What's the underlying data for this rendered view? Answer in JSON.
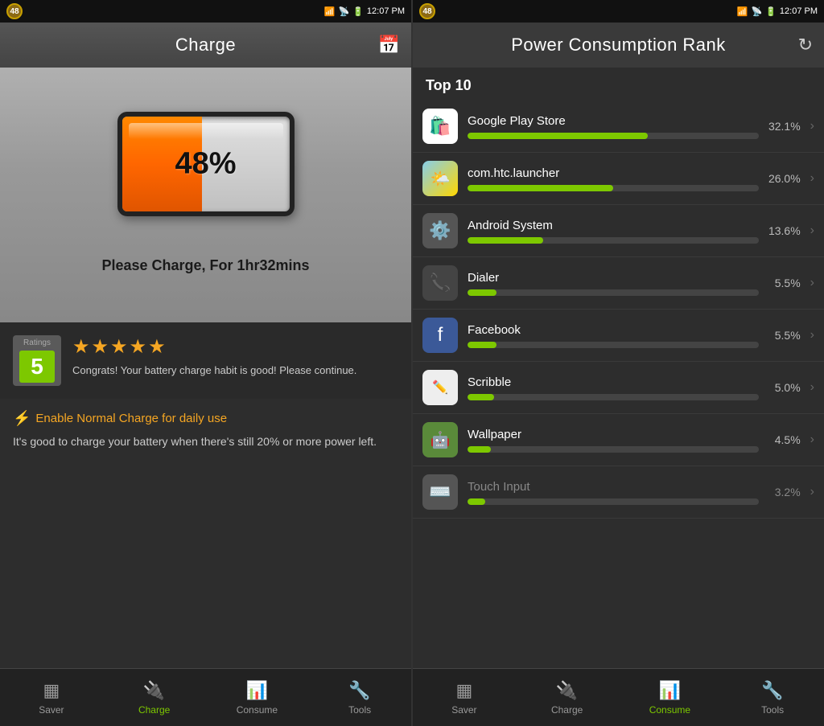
{
  "statusBar": {
    "badge": "48",
    "time": "12:07 PM"
  },
  "leftPanel": {
    "header": {
      "title": "Charge",
      "icon": "📅"
    },
    "battery": {
      "percent": "48%",
      "fillWidth": "48%"
    },
    "chargeMessage": "Please Charge, For 1hr32mins",
    "ratings": {
      "label": "Ratings",
      "score": "5",
      "stars": "★★★★★",
      "text": "Congrats! Your battery charge habit is good! Please continue."
    },
    "tip": {
      "title": "Enable Normal Charge for daily use",
      "text": "It's good to charge your battery when there's still 20% or more power left."
    },
    "nav": [
      {
        "id": "saver",
        "label": "Saver",
        "active": false
      },
      {
        "id": "charge",
        "label": "Charge",
        "active": true
      },
      {
        "id": "consume",
        "label": "Consume",
        "active": false
      },
      {
        "id": "tools",
        "label": "Tools",
        "active": false
      }
    ]
  },
  "rightPanel": {
    "header": {
      "title": "Power Consumption Rank",
      "icon": "↻"
    },
    "top10Label": "Top 10",
    "apps": [
      {
        "name": "Google Play Store",
        "percent": "32.1%",
        "barWidth": "62%",
        "icon": "🛍️",
        "iconClass": "icon-playstore"
      },
      {
        "name": "com.htc.launcher",
        "percent": "26.0%",
        "barWidth": "50%",
        "icon": "🌤️",
        "iconClass": "icon-weather"
      },
      {
        "name": "Android System",
        "percent": "13.6%",
        "barWidth": "26%",
        "icon": "⚙️",
        "iconClass": "icon-android-sys"
      },
      {
        "name": "Dialer",
        "percent": "5.5%",
        "barWidth": "10%",
        "icon": "📞",
        "iconClass": "icon-dialer"
      },
      {
        "name": "Facebook",
        "percent": "5.5%",
        "barWidth": "10%",
        "icon": "f",
        "iconClass": "icon-facebook"
      },
      {
        "name": "Scribble",
        "percent": "5.0%",
        "barWidth": "9%",
        "icon": "✏️",
        "iconClass": "icon-scribble"
      },
      {
        "name": "Wallpaper",
        "percent": "4.5%",
        "barWidth": "8%",
        "icon": "🤖",
        "iconClass": "icon-wallpaper"
      },
      {
        "name": "Touch Input",
        "percent": "3.2%",
        "barWidth": "6%",
        "icon": "⌨️",
        "iconClass": "icon-android-sys"
      }
    ],
    "nav": [
      {
        "id": "saver",
        "label": "Saver",
        "active": false
      },
      {
        "id": "charge",
        "label": "Charge",
        "active": false
      },
      {
        "id": "consume",
        "label": "Consume",
        "active": true
      },
      {
        "id": "tools",
        "label": "Tools",
        "active": false
      }
    ]
  }
}
